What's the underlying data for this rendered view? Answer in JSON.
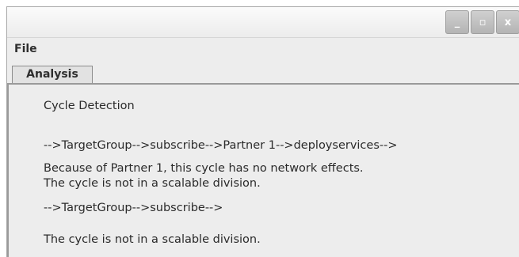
{
  "window": {
    "controls": {
      "minimize": "_",
      "maximize": "▫",
      "close": "x"
    }
  },
  "menubar": {
    "file_label": "File"
  },
  "tabs": [
    {
      "label": "Analysis",
      "selected": true
    }
  ],
  "analysis": {
    "heading": "Cycle Detection",
    "lines": [
      "-->TargetGroup-->subscribe-->Partner 1-->deployservices-->",
      "Because of Partner 1, this cycle has no network effects.",
      "The cycle is not in a scalable division.",
      "-->TargetGroup-->subscribe-->",
      "The cycle is not in a scalable division."
    ]
  }
}
